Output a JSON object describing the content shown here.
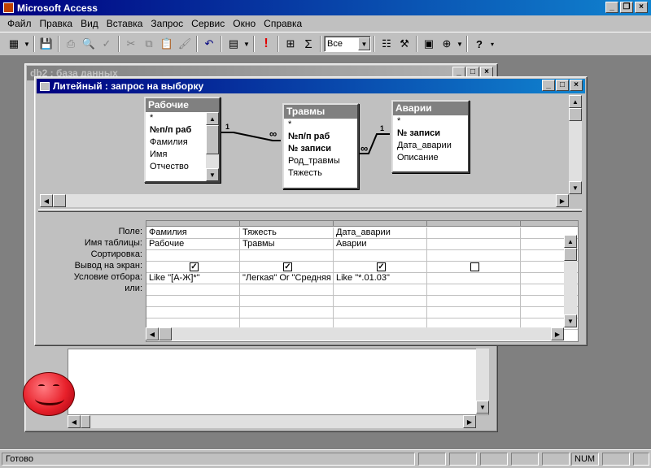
{
  "app": {
    "title": "Microsoft Access"
  },
  "menu": [
    "Файл",
    "Правка",
    "Вид",
    "Вставка",
    "Запрос",
    "Сервис",
    "Окно",
    "Справка"
  ],
  "toolbar": {
    "combo_value": "Все",
    "sigma": "Σ",
    "bang": "!"
  },
  "db_window": {
    "title": "db2 : база данных"
  },
  "query_window": {
    "title": "Литейный : запрос на выборку",
    "tables": [
      {
        "name": "Рабочие",
        "fields": [
          "*",
          "№п/п раб",
          "Фамилия",
          "Имя",
          "Отчество"
        ],
        "bold": [
          1
        ]
      },
      {
        "name": "Травмы",
        "fields": [
          "*",
          "№п/п раб",
          "№ записи",
          "Род_травмы",
          "Тяжесть"
        ],
        "bold": [
          1,
          2
        ]
      },
      {
        "name": "Аварии",
        "fields": [
          "*",
          "№ записи",
          "Дата_аварии",
          "Описание"
        ],
        "bold": [
          1
        ]
      }
    ],
    "joins": [
      {
        "one": "1",
        "many": "∞"
      },
      {
        "one": "1",
        "many": "∞"
      }
    ],
    "grid_labels": [
      "Поле:",
      "Имя таблицы:",
      "Сортировка:",
      "Вывод на экран:",
      "Условие отбора:",
      "или:"
    ],
    "columns": [
      {
        "field": "Фамилия",
        "table": "Рабочие",
        "sort": "",
        "show": true,
        "criteria": "Like \"[А-Ж]*\"",
        "or": ""
      },
      {
        "field": "Тяжесть",
        "table": "Травмы",
        "sort": "",
        "show": true,
        "criteria": "\"Легкая\" Or \"Средняя",
        "or": ""
      },
      {
        "field": "Дата_аварии",
        "table": "Аварии",
        "sort": "",
        "show": true,
        "criteria": "Like \"*.01.03\"",
        "or": ""
      },
      {
        "field": "",
        "table": "",
        "sort": "",
        "show": false,
        "criteria": "",
        "or": ""
      },
      {
        "field": "",
        "table": "",
        "sort": "",
        "show": false,
        "criteria": "",
        "or": ""
      }
    ]
  },
  "status": {
    "text": "Готово",
    "num": "NUM"
  },
  "colors": {
    "title_active": "#000080",
    "title_inactive": "#808080",
    "face": "#c0c0c0",
    "assistant": "#e8202a"
  }
}
